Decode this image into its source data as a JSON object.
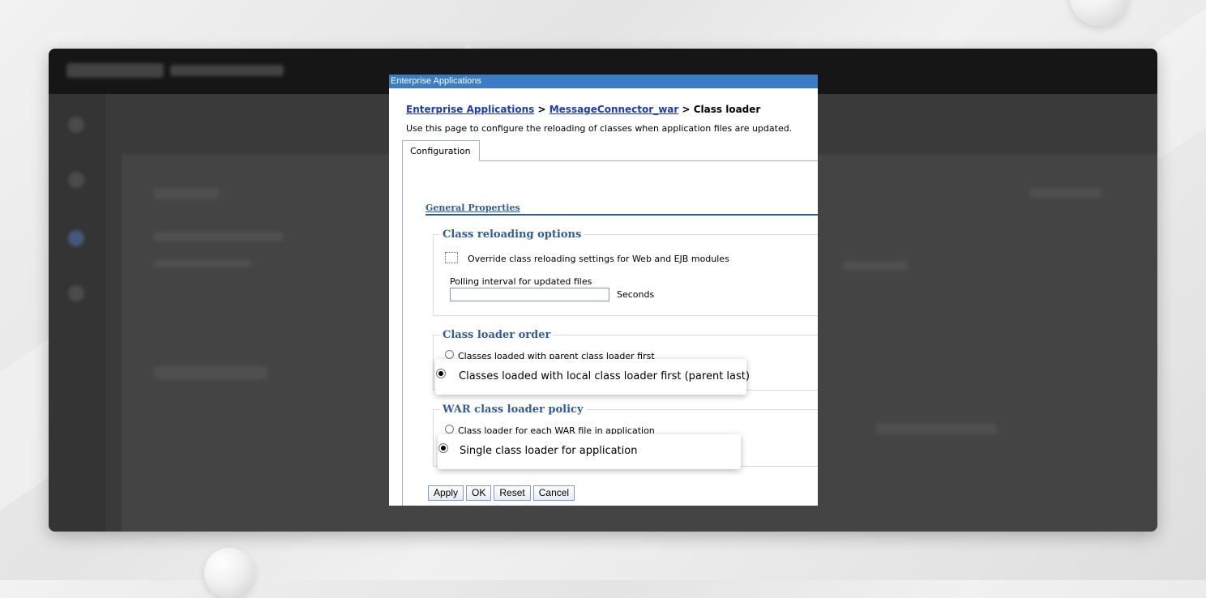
{
  "window": {
    "title": "Enterprise Applications"
  },
  "breadcrumb": {
    "link1": "Enterprise Applications",
    "sep1": " > ",
    "link2": "MessageConnector_war",
    "sep2": " > ",
    "current": "Class loader"
  },
  "description": "Use this page to configure the reloading of classes when application files are updated.",
  "tabs": [
    {
      "label": "Configuration",
      "active": true
    }
  ],
  "general_properties": {
    "title": "General Properties"
  },
  "class_reloading": {
    "legend": "Class reloading options",
    "override_label": "Override class reloading settings for Web and EJB modules",
    "override_checked": false,
    "polling_label": "Polling interval for updated files",
    "polling_value": "",
    "polling_unit": "Seconds"
  },
  "class_loader_order": {
    "legend": "Class loader order",
    "option_parent_first": "Classes loaded with parent class loader first",
    "option_local_first": "Classes loaded with local class loader first (parent last)",
    "selected": "local_first"
  },
  "war_policy": {
    "legend": "WAR class loader policy",
    "option_each_war": "Class loader for each WAR file in application",
    "option_single": "Single class loader for application",
    "selected": "single"
  },
  "buttons": {
    "apply": "Apply",
    "ok": "OK",
    "reset": "Reset",
    "cancel": "Cancel"
  },
  "colors": {
    "titlebar": "#3b7cc7",
    "link": "#1a3cb8",
    "section": "#2f5d96"
  }
}
